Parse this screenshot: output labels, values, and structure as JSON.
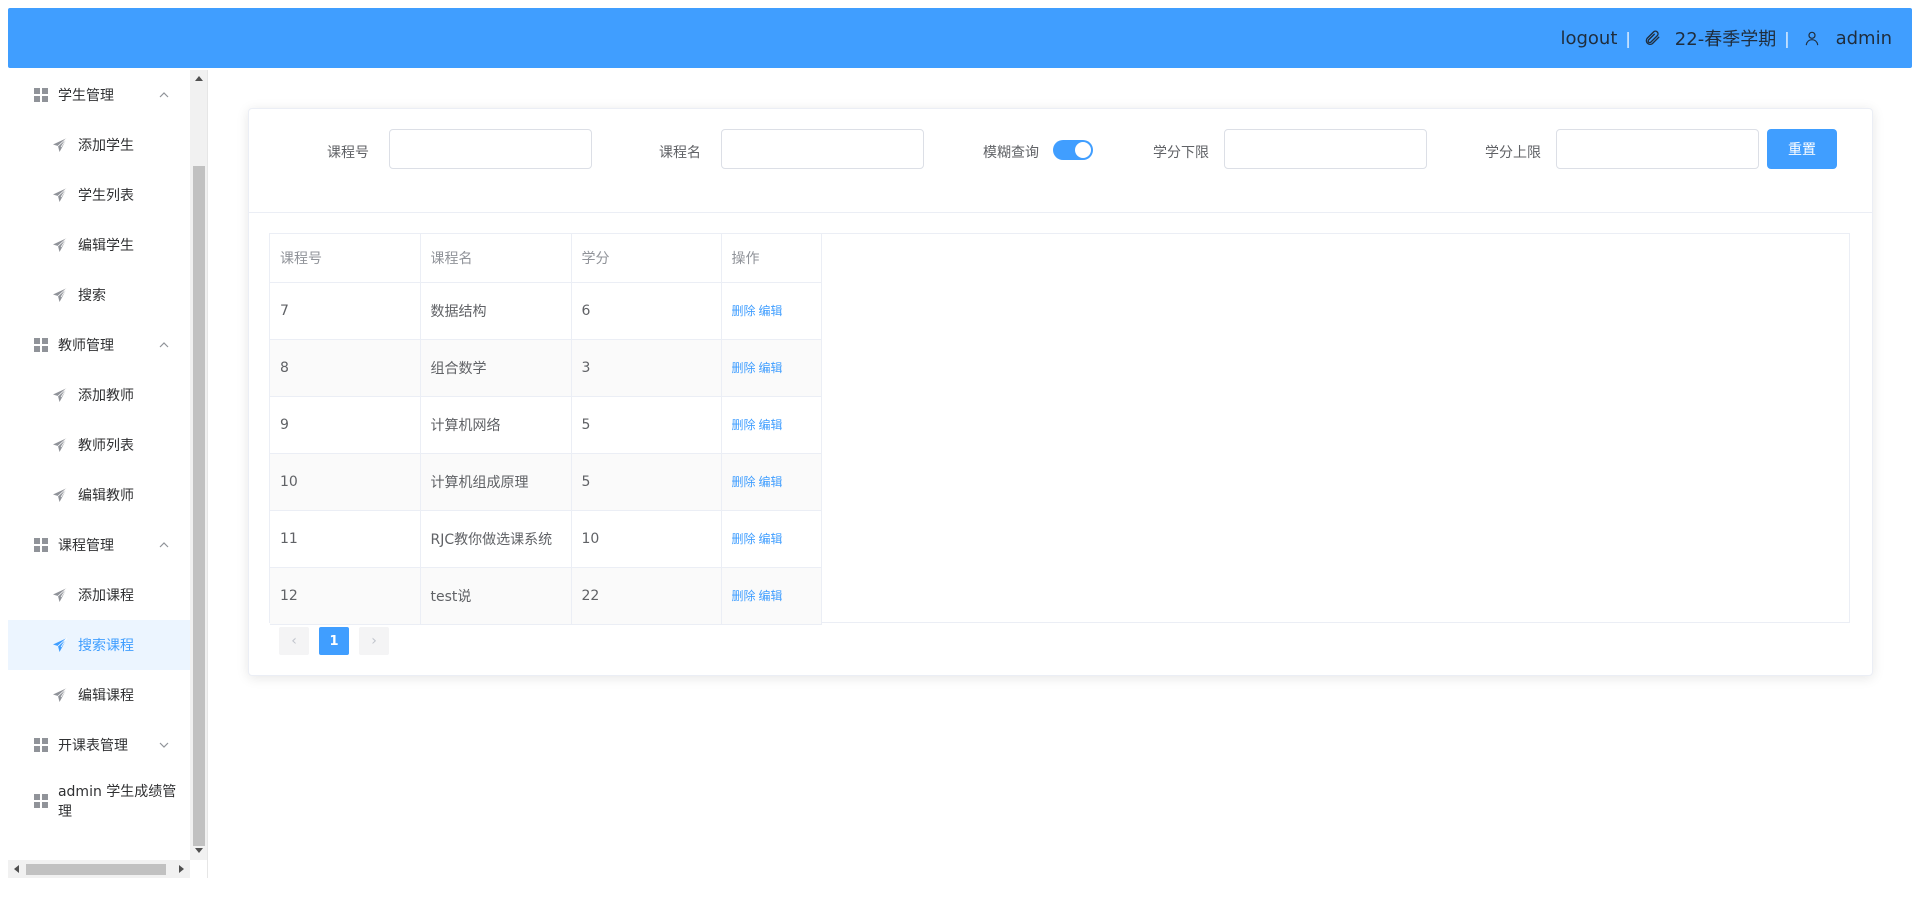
{
  "header": {
    "logout_label": "logout",
    "semester": "22-春季学期",
    "username": "admin",
    "background_color": "#409eff"
  },
  "sidebar": {
    "groups": [
      {
        "label": "学生管理",
        "expanded": true,
        "items": [
          "添加学生",
          "学生列表",
          "编辑学生",
          "搜索"
        ]
      },
      {
        "label": "教师管理",
        "expanded": true,
        "items": [
          "添加教师",
          "教师列表",
          "编辑教师"
        ]
      },
      {
        "label": "课程管理",
        "expanded": true,
        "items": [
          "添加课程",
          "搜索课程",
          "编辑课程"
        ]
      },
      {
        "label": "开课表管理",
        "expanded": false,
        "items": []
      },
      {
        "label": "admin 学生成绩管理",
        "expanded": false,
        "items": []
      }
    ],
    "active_item": "搜索课程",
    "active_color": "#409eff"
  },
  "search_form": {
    "course_no_label": "课程号",
    "course_no_value": "",
    "course_name_label": "课程名",
    "course_name_value": "",
    "fuzzy_label": "模糊查询",
    "fuzzy_enabled": true,
    "credit_min_label": "学分下限",
    "credit_min_value": "",
    "credit_max_label": "学分上限",
    "credit_max_value": "",
    "reset_label": "重置"
  },
  "table": {
    "columns": [
      "课程号",
      "课程名",
      "学分",
      "操作"
    ],
    "rows": [
      {
        "id": "7",
        "name": "数据结构",
        "credit": "6"
      },
      {
        "id": "8",
        "name": "组合数学",
        "credit": "3"
      },
      {
        "id": "9",
        "name": "计算机网络",
        "credit": "5"
      },
      {
        "id": "10",
        "name": "计算机组成原理",
        "credit": "5"
      },
      {
        "id": "11",
        "name": "RJC教你做选课系统",
        "credit": "10"
      },
      {
        "id": "12",
        "name": "test说",
        "credit": "22"
      }
    ],
    "delete_label": "删除",
    "edit_label": "编辑"
  },
  "pagination": {
    "prev_icon": "‹",
    "current_page": "1",
    "next_icon": "›"
  }
}
